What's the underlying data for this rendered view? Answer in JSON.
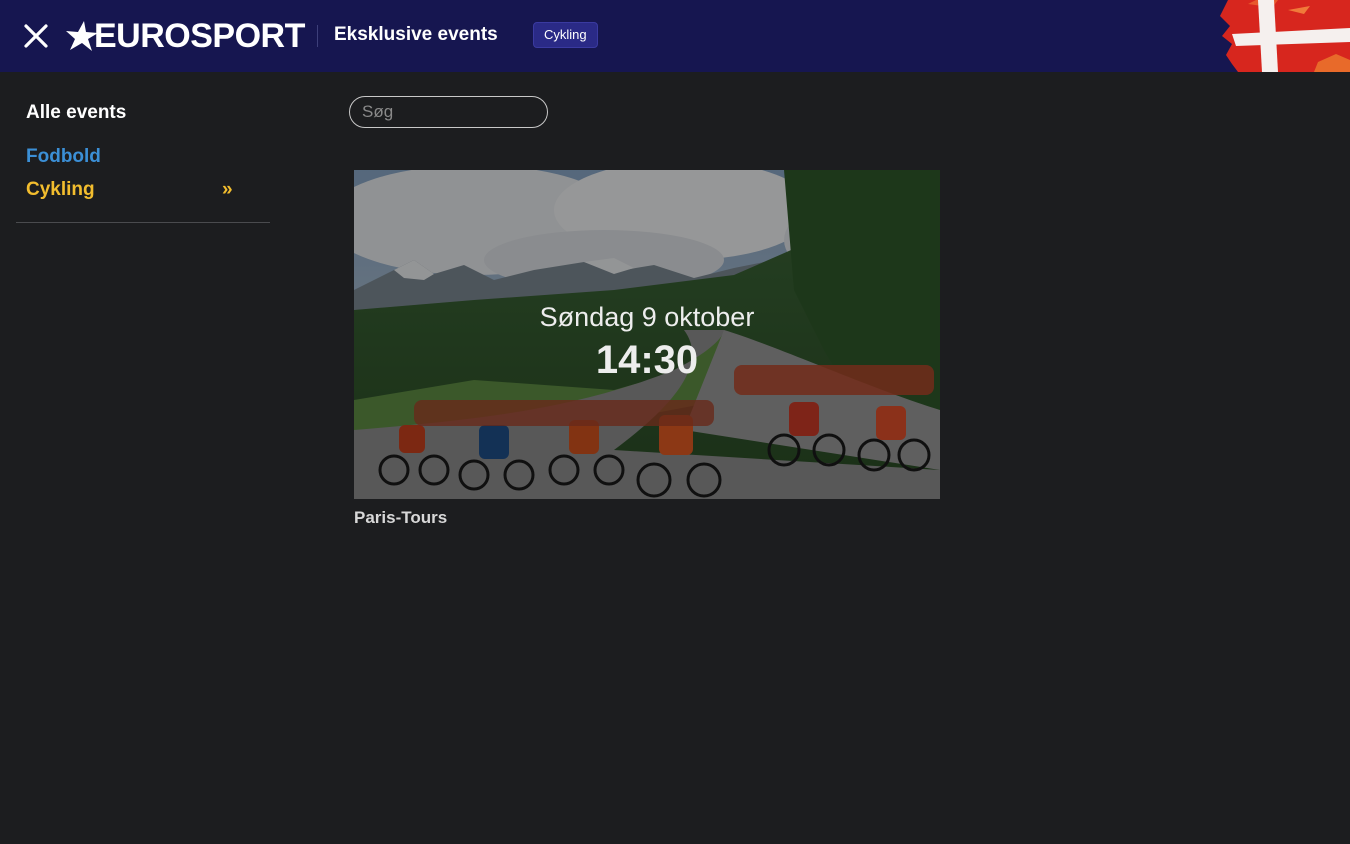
{
  "header": {
    "brand": "EUROSPORT",
    "section_title": "Eksklusive events",
    "tag": "Cykling"
  },
  "sidebar": {
    "title": "Alle events",
    "items": [
      {
        "label": "Fodbold",
        "active": false
      },
      {
        "label": "Cykling",
        "active": true
      }
    ],
    "active_marker": "»"
  },
  "search": {
    "placeholder": "Søg",
    "value": ""
  },
  "events": [
    {
      "date": "Søndag 9 oktober",
      "time": "14:30",
      "title": "Paris-Tours"
    }
  ],
  "colors": {
    "header_bg": "#161650",
    "page_bg": "#1c1d1f",
    "link_blue": "#3b8fd6",
    "active_yellow": "#f2bd2e",
    "flag_red": "#d7261e"
  },
  "icons": [
    "close-icon",
    "eurosport-logo",
    "denmark-flag",
    "chevron-double-right-icon"
  ]
}
